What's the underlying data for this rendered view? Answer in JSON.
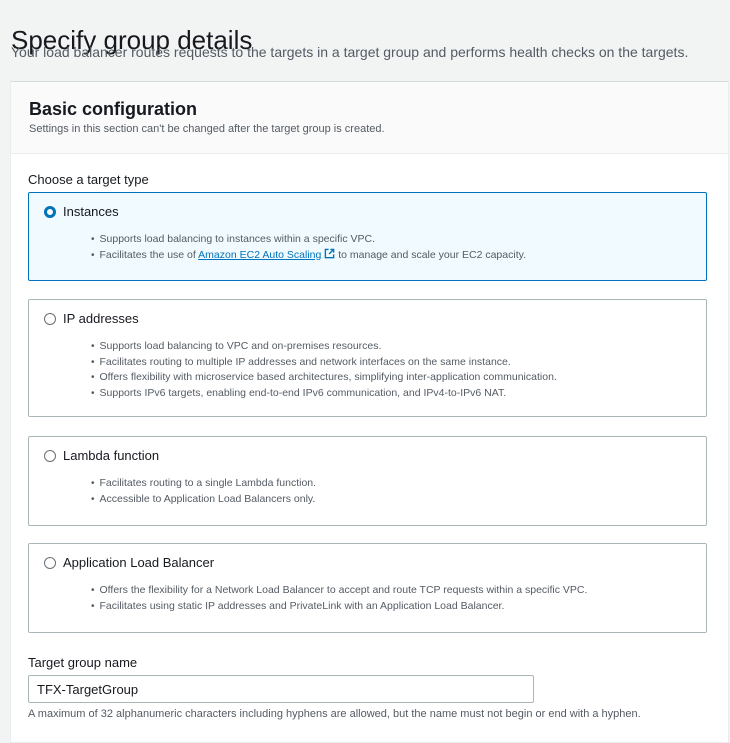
{
  "page": {
    "title": "Specify group details",
    "description": "Your load balancer routes requests to the targets in a target group and performs health checks on the targets."
  },
  "panel": {
    "title": "Basic configuration",
    "subtitle": "Settings in this section can't be changed after the target group is created."
  },
  "target_type": {
    "label": "Choose a target type",
    "selected": "instances",
    "options": [
      {
        "id": "instances",
        "label": "Instances",
        "bullets": [
          "Supports load balancing to instances within a specific VPC."
        ],
        "autoscaling_prefix": "Facilitates the use of",
        "autoscaling_link": "Amazon EC2 Auto Scaling",
        "autoscaling_suffix": "to manage and scale your EC2 capacity."
      },
      {
        "id": "ip",
        "label": "IP addresses",
        "bullets": [
          "Supports load balancing to VPC and on-premises resources.",
          "Facilitates routing to multiple IP addresses and network interfaces on the same instance.",
          "Offers flexibility with microservice based architectures, simplifying inter-application communication.",
          "Supports IPv6 targets, enabling end-to-end IPv6 communication, and IPv4-to-IPv6 NAT."
        ]
      },
      {
        "id": "lambda",
        "label": "Lambda function",
        "bullets": [
          "Facilitates routing to a single Lambda function.",
          "Accessible to Application Load Balancers only."
        ]
      },
      {
        "id": "alb",
        "label": "Application Load Balancer",
        "bullets": [
          "Offers the flexibility for a Network Load Balancer to accept and route TCP requests within a specific VPC.",
          "Facilitates using static IP addresses and PrivateLink with an Application Load Balancer."
        ]
      }
    ]
  },
  "target_group_name": {
    "label": "Target group name",
    "value": "TFX-TargetGroup",
    "constraint": "A maximum of 32 alphanumeric characters including hyphens are allowed, but the name must not begin or end with a hyphen."
  },
  "icons": {
    "external_link": "external-link-icon"
  },
  "colors": {
    "accent": "#0073bb",
    "selected_bg": "#f1faff",
    "border": "#aab7b8"
  }
}
